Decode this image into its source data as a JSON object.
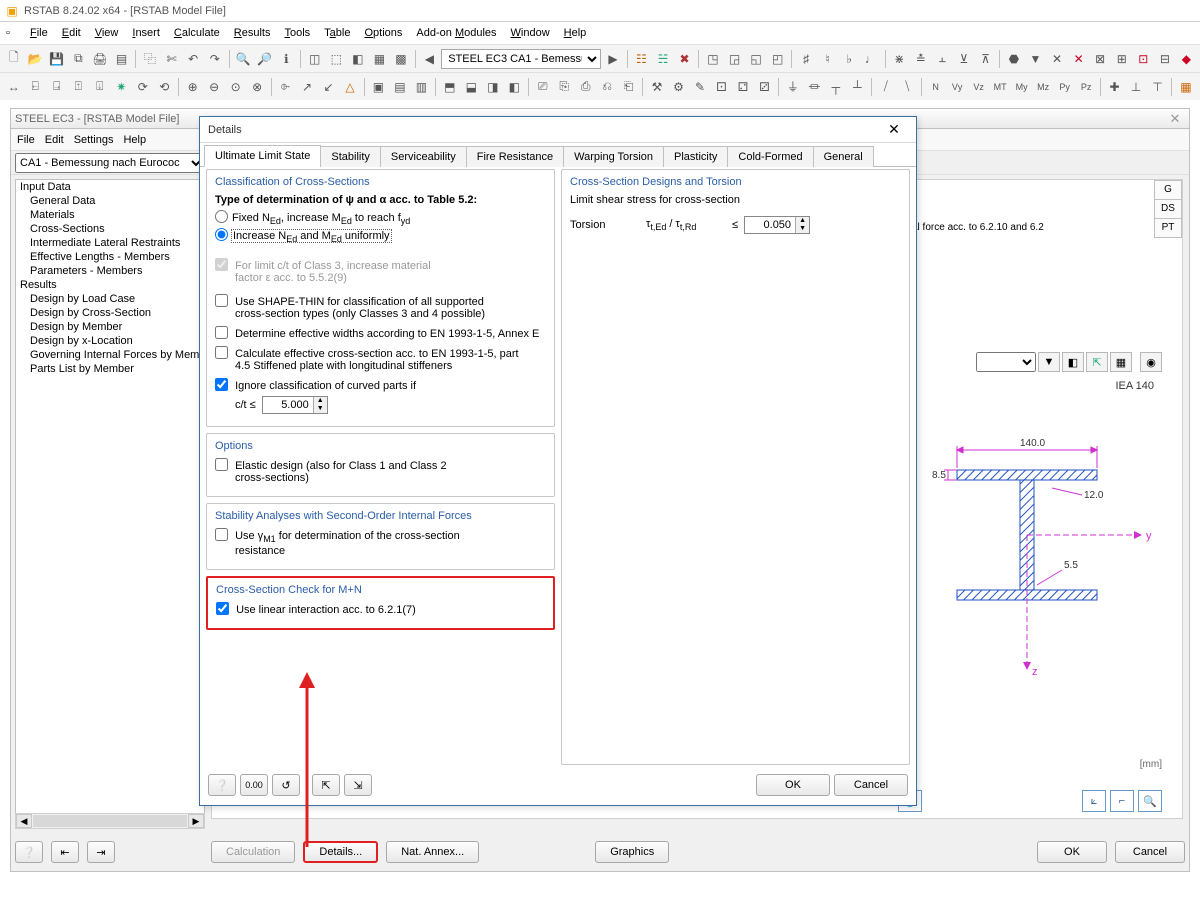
{
  "app": {
    "title": "RSTAB 8.24.02 x64 - [RSTAB Model File]",
    "child_title": "STEEL EC3 - [RSTAB Model File]",
    "main_combo": "STEEL EC3 CA1 - Bemessunç"
  },
  "menus": {
    "main": [
      "File",
      "Edit",
      "View",
      "Insert",
      "Calculate",
      "Results",
      "Tools",
      "Table",
      "Options",
      "Add-on Modules",
      "Window",
      "Help"
    ],
    "child": [
      "File",
      "Edit",
      "Settings",
      "Help"
    ]
  },
  "left_selector": "CA1 - Bemessung nach Eurococ",
  "tree": {
    "input_root": "Input Data",
    "input": [
      "General Data",
      "Materials",
      "Cross-Sections",
      "Intermediate Lateral Restraints",
      "Effective Lengths - Members",
      "Parameters - Members"
    ],
    "results_root": "Results",
    "results": [
      "Design by Load Case",
      "Design by Cross-Section",
      "Design by Member",
      "Design by x-Location",
      "Governing Internal Forces by Member",
      "Parts List by Member"
    ]
  },
  "right": {
    "tags": [
      "G",
      "DS",
      "PT"
    ],
    "row_text": "al force acc. to 6.2.10 and 6.2",
    "section": "IEA 140",
    "dim_top": "140.0",
    "dim_flange": "8.5",
    "dim_web": "12.0",
    "dim_r": "5.5",
    "axis_y": "y",
    "axis_z": "z",
    "unit": "[mm]"
  },
  "dialog": {
    "title": "Details",
    "tabs": [
      "Ultimate Limit State",
      "Stability",
      "Serviceability",
      "Fire Resistance",
      "Warping Torsion",
      "Plasticity",
      "Cold-Formed",
      "General"
    ],
    "g1_title": "Classification of Cross-Sections",
    "g1_lead": "Type of determination of ψ and α acc. to Table 5.2:",
    "g1_r1": "Fixed NEd, increase MEd to reach fyd",
    "g1_r2": "Increase NEd and MEd uniformly",
    "g1_c1a": "For limit c/t of Class 3, increase material",
    "g1_c1b": "factor ε acc. to 5.5.2(9)",
    "g1_c2a": "Use SHAPE-THIN for classification of all supported",
    "g1_c2b": "cross-section types (only Classes 3 and 4 possible)",
    "g1_c3": "Determine effective widths according to EN 1993-1-5, Annex E",
    "g1_c4a": "Calculate effective cross-section acc. to EN 1993-1-5, part",
    "g1_c4b": "4.5 Stiffened plate with longitudinal stiffeners",
    "g1_c5": "Ignore classification of curved parts if",
    "g1_ct_lbl": "c/t ≤",
    "g1_ct_val": "5.000",
    "g2_title": "Options",
    "g2_c1a": "Elastic design (also for Class 1 and Class 2",
    "g2_c1b": "cross-sections)",
    "g3_title": "Stability Analyses with Second-Order Internal Forces",
    "g3_c1a": "Use γM1 for determination of the cross-section",
    "g3_c1b": "resistance",
    "g4_title": "Cross-Section Check for M+N",
    "g4_c1": "Use linear interaction acc. to 6.2.1(7)",
    "gR_title": "Cross-Section Designs and Torsion",
    "gR_l1": "Limit shear stress for cross-section",
    "gR_l2_a": "Torsion",
    "gR_l2_b": "τt,Ed / τt,Rd",
    "gR_l2_c": "≤",
    "gR_val": "0.050",
    "ok": "OK",
    "cancel": "Cancel"
  },
  "bottom": {
    "calc": "Calculation",
    "details": "Details...",
    "annex": "Nat. Annex...",
    "graphics": "Graphics",
    "ok": "OK",
    "cancel": "Cancel"
  }
}
